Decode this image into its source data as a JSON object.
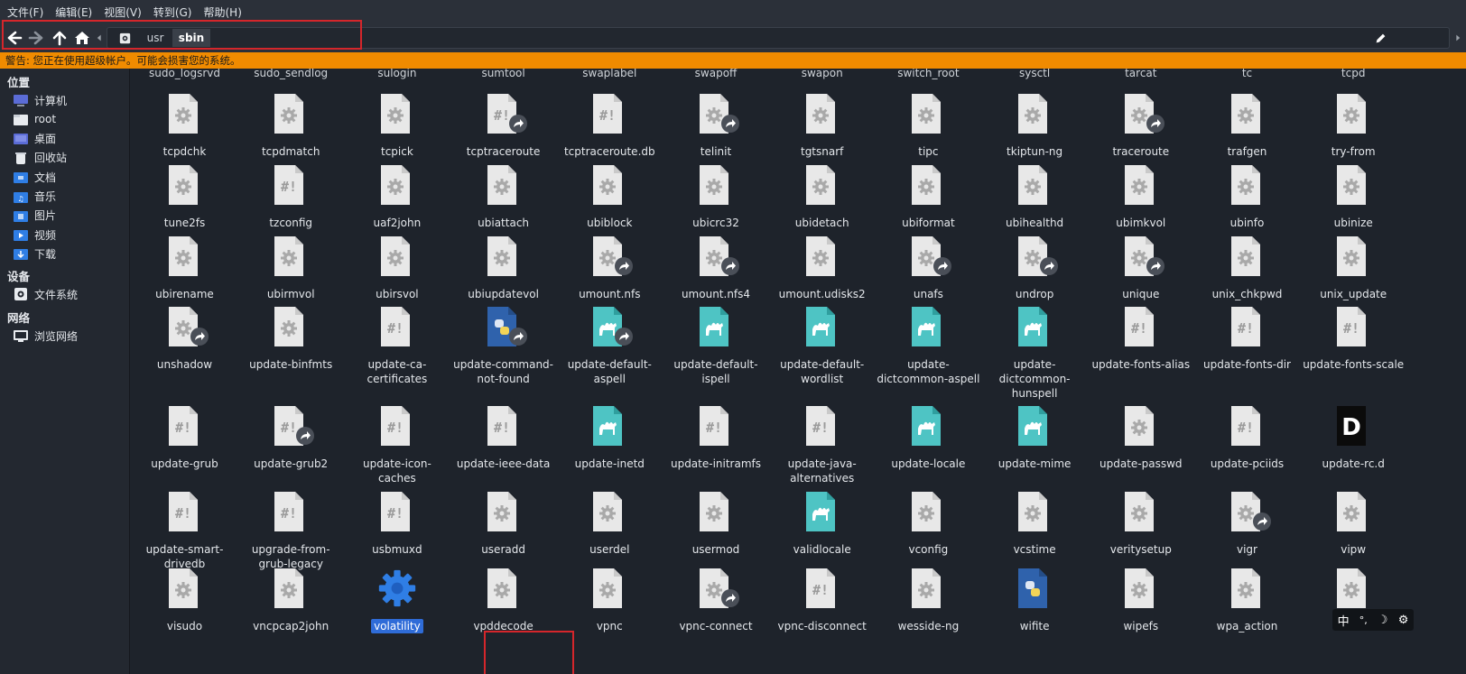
{
  "menu": [
    "文件(F)",
    "编辑(E)",
    "视图(V)",
    "转到(G)",
    "帮助(H)"
  ],
  "path": {
    "root_icon": "drive-root-icon",
    "crumbs": [
      "usr",
      "sbin"
    ]
  },
  "warning": "警告: 您正在使用超级帐户。可能会损害您的系统。",
  "sidebar": {
    "places_label": "位置",
    "places": [
      {
        "label": "计算机",
        "icon": "computer-icon"
      },
      {
        "label": "root",
        "icon": "home-folder-icon"
      },
      {
        "label": "桌面",
        "icon": "desktop-icon"
      },
      {
        "label": "回收站",
        "icon": "trash-icon"
      },
      {
        "label": "文档",
        "icon": "documents-folder-icon"
      },
      {
        "label": "音乐",
        "icon": "music-folder-icon"
      },
      {
        "label": "图片",
        "icon": "pictures-folder-icon"
      },
      {
        "label": "视频",
        "icon": "videos-folder-icon"
      },
      {
        "label": "下载",
        "icon": "downloads-folder-icon"
      }
    ],
    "devices_label": "设备",
    "devices": [
      {
        "label": "文件系统",
        "icon": "drive-icon"
      }
    ],
    "network_label": "网络",
    "network": [
      {
        "label": "浏览网络",
        "icon": "network-icon"
      }
    ]
  },
  "top_partial": [
    "sudo_logsrvd",
    "sudo_sendlog",
    "sulogin",
    "sumtool",
    "swaplabel",
    "swapoff",
    "swapon",
    "switch_root",
    "sysctl",
    "tarcat",
    "tc",
    "tcpd"
  ],
  "rows": [
    [
      {
        "name": "tcpdchk",
        "type": "binary"
      },
      {
        "name": "tcpdmatch",
        "type": "binary"
      },
      {
        "name": "tcpick",
        "type": "binary"
      },
      {
        "name": "tcptraceroute",
        "type": "script",
        "link": true
      },
      {
        "name": "tcptraceroute.db",
        "type": "script"
      },
      {
        "name": "telinit",
        "type": "binary",
        "link": true
      },
      {
        "name": "tgtsnarf",
        "type": "binary"
      },
      {
        "name": "tipc",
        "type": "binary"
      },
      {
        "name": "tkiptun-ng",
        "type": "binary"
      },
      {
        "name": "traceroute",
        "type": "binary",
        "link": true
      },
      {
        "name": "trafgen",
        "type": "binary"
      },
      {
        "name": "try-from",
        "type": "binary"
      }
    ],
    [
      {
        "name": "tune2fs",
        "type": "binary"
      },
      {
        "name": "tzconfig",
        "type": "script"
      },
      {
        "name": "uaf2john",
        "type": "binary"
      },
      {
        "name": "ubiattach",
        "type": "binary"
      },
      {
        "name": "ubiblock",
        "type": "binary"
      },
      {
        "name": "ubicrc32",
        "type": "binary"
      },
      {
        "name": "ubidetach",
        "type": "binary"
      },
      {
        "name": "ubiformat",
        "type": "binary"
      },
      {
        "name": "ubihealthd",
        "type": "binary"
      },
      {
        "name": "ubimkvol",
        "type": "binary"
      },
      {
        "name": "ubinfo",
        "type": "binary"
      },
      {
        "name": "ubinize",
        "type": "binary"
      }
    ],
    [
      {
        "name": "ubirename",
        "type": "binary"
      },
      {
        "name": "ubirmvol",
        "type": "binary"
      },
      {
        "name": "ubirsvol",
        "type": "binary"
      },
      {
        "name": "ubiupdatevol",
        "type": "binary"
      },
      {
        "name": "umount.nfs",
        "type": "binary",
        "link": true
      },
      {
        "name": "umount.nfs4",
        "type": "binary",
        "link": true
      },
      {
        "name": "umount.udisks2",
        "type": "binary"
      },
      {
        "name": "unafs",
        "type": "binary",
        "link": true
      },
      {
        "name": "undrop",
        "type": "binary",
        "link": true
      },
      {
        "name": "unique",
        "type": "binary",
        "link": true
      },
      {
        "name": "unix_chkpwd",
        "type": "binary"
      },
      {
        "name": "unix_update",
        "type": "binary"
      }
    ],
    [
      {
        "name": "unshadow",
        "type": "binary",
        "link": true
      },
      {
        "name": "update-binfmts",
        "type": "binary"
      },
      {
        "name": "update-ca-certificates",
        "type": "script"
      },
      {
        "name": "update-command-not-found",
        "type": "python",
        "link": true
      },
      {
        "name": "update-default-aspell",
        "type": "perl",
        "link": true
      },
      {
        "name": "update-default-ispell",
        "type": "perl"
      },
      {
        "name": "update-default-wordlist",
        "type": "perl"
      },
      {
        "name": "update-dictcommon-aspell",
        "type": "perl"
      },
      {
        "name": "update-dictcommon-hunspell",
        "type": "perl"
      },
      {
        "name": "update-fonts-alias",
        "type": "script"
      },
      {
        "name": "update-fonts-dir",
        "type": "script"
      },
      {
        "name": "update-fonts-scale",
        "type": "script"
      }
    ],
    [
      {
        "name": "update-grub",
        "type": "script"
      },
      {
        "name": "update-grub2",
        "type": "script",
        "link": true
      },
      {
        "name": "update-icon-caches",
        "type": "script"
      },
      {
        "name": "update-ieee-data",
        "type": "script"
      },
      {
        "name": "update-inetd",
        "type": "perl"
      },
      {
        "name": "update-initramfs",
        "type": "script"
      },
      {
        "name": "update-java-alternatives",
        "type": "script"
      },
      {
        "name": "update-locale",
        "type": "perl"
      },
      {
        "name": "update-mime",
        "type": "perl"
      },
      {
        "name": "update-passwd",
        "type": "binary"
      },
      {
        "name": "update-pciids",
        "type": "script"
      },
      {
        "name": "update-rc.d",
        "type": "dlang"
      }
    ],
    [
      {
        "name": "update-smart-drivedb",
        "type": "script"
      },
      {
        "name": "upgrade-from-grub-legacy",
        "type": "script"
      },
      {
        "name": "usbmuxd",
        "type": "script"
      },
      {
        "name": "useradd",
        "type": "binary"
      },
      {
        "name": "userdel",
        "type": "binary"
      },
      {
        "name": "usermod",
        "type": "binary"
      },
      {
        "name": "validlocale",
        "type": "perl"
      },
      {
        "name": "vconfig",
        "type": "binary"
      },
      {
        "name": "vcstime",
        "type": "binary"
      },
      {
        "name": "veritysetup",
        "type": "binary"
      },
      {
        "name": "vigr",
        "type": "binary",
        "link": true
      },
      {
        "name": "vipw",
        "type": "binary"
      }
    ],
    [
      {
        "name": "visudo",
        "type": "binary"
      },
      {
        "name": "vncpcap2john",
        "type": "binary"
      },
      {
        "name": "volatility",
        "type": "gear-blue",
        "selected": true
      },
      {
        "name": "vpddecode",
        "type": "binary"
      },
      {
        "name": "vpnc",
        "type": "binary"
      },
      {
        "name": "vpnc-connect",
        "type": "binary",
        "link": true
      },
      {
        "name": "vpnc-disconnect",
        "type": "script"
      },
      {
        "name": "wesside-ng",
        "type": "binary"
      },
      {
        "name": "wifite",
        "type": "python"
      },
      {
        "name": "wipefs",
        "type": "binary"
      },
      {
        "name": "wpa_action",
        "type": "binary"
      },
      {
        "name": "",
        "type": "binary"
      }
    ]
  ],
  "tray": {
    "ime_label": "中"
  },
  "colors": {
    "warning": "#f08b00",
    "selection": "#2f6cd8",
    "highlight_box": "#d5262b"
  }
}
